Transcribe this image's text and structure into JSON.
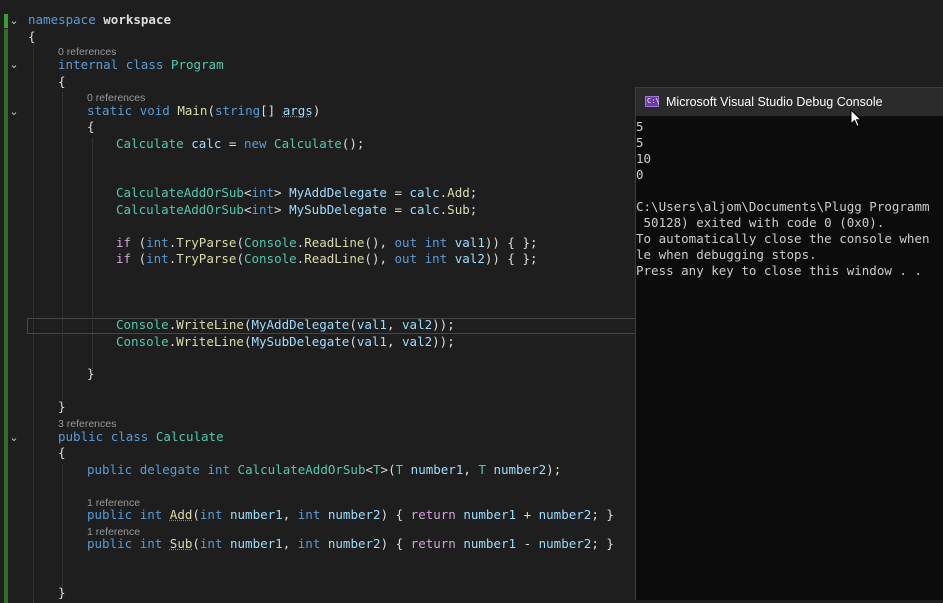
{
  "editor": {
    "lines": {
      "l1_kw": "namespace",
      "l1_name": "workspace",
      "l2": "{",
      "lens1": "0 references",
      "l3_kw1": "internal",
      "l3_kw2": "class",
      "l3_name": "Program",
      "l4": "{",
      "lens2": "0 references",
      "l5_kw1": "static",
      "l5_kw2": "void",
      "l5_fn": "Main",
      "l5_p1": "(",
      "l5_kw3": "string",
      "l5_p2": "[] ",
      "l5_arg": "args",
      "l5_p3": ")",
      "l6": "{",
      "l7_ty1": "Calculate",
      "l7_var": " calc",
      "l7_p1": " = ",
      "l7_kw": "new",
      "l7_ty2": " Calculate",
      "l7_p2": "();",
      "l8_ty": "CalculateAddOrSub",
      "l8_p1": "<",
      "l8_kw": "int",
      "l8_p2": "> ",
      "l8_var": "MyAddDelegate",
      "l8_p3": " = ",
      "l8_obj": "calc",
      "l8_p4": ".",
      "l8_m": "Add",
      "l8_p5": ";",
      "l9_ty": "CalculateAddOrSub",
      "l9_p1": "<",
      "l9_kw": "int",
      "l9_p2": "> ",
      "l9_var": "MySubDelegate",
      "l9_p3": " = ",
      "l9_obj": "calc",
      "l9_p4": ".",
      "l9_m": "Sub",
      "l9_p5": ";",
      "l10_if": "if",
      "l10_p1": " (",
      "l10_kw": "int",
      "l10_p2": ".",
      "l10_fn": "TryParse",
      "l10_p3": "(",
      "l10_ty": "Console",
      "l10_p4": ".",
      "l10_fn2": "ReadLine",
      "l10_p5": "(), ",
      "l10_out": "out",
      "l10_sp": " ",
      "l10_kw2": "int",
      "l10_var": " val1",
      "l10_p6": ")) { };",
      "l11_if": "if",
      "l11_p1": " (",
      "l11_kw": "int",
      "l11_p2": ".",
      "l11_fn": "TryParse",
      "l11_p3": "(",
      "l11_ty": "Console",
      "l11_p4": ".",
      "l11_fn2": "ReadLine",
      "l11_p5": "(), ",
      "l11_out": "out",
      "l11_sp": " ",
      "l11_kw2": "int",
      "l11_var": " val2",
      "l11_p6": ")) { };",
      "l12_ty": "Console",
      "l12_p1": ".",
      "l12_fn": "WriteLine",
      "l12_p2": "(",
      "l12_fn2": "MyAddDelegate",
      "l12_p3": "(",
      "l12_v1": "val1",
      "l12_p4": ", ",
      "l12_v2": "val2",
      "l12_p5": "));",
      "l13_ty": "Console",
      "l13_p1": ".",
      "l13_fn": "WriteLine",
      "l13_p2": "(",
      "l13_fn2": "MySubDelegate",
      "l13_p3": "(",
      "l13_v1": "val1",
      "l13_p4": ", ",
      "l13_v2": "val2",
      "l13_p5": "));",
      "l14": "}",
      "l15": "}",
      "lens3": "3 references",
      "l16_kw1": "public",
      "l16_kw2": "class",
      "l16_name": "Calculate",
      "l17": "{",
      "l18_kw1": "public",
      "l18_kw2": "delegate",
      "l18_kw3": "int",
      "l18_ty": "CalculateAddOrSub",
      "l18_p1": "<",
      "l18_t1": "T",
      "l18_p2": ">(",
      "l18_t2": "T",
      "l18_v1": " number1",
      "l18_p3": ", ",
      "l18_t3": "T",
      "l18_v2": " number2",
      "l18_p4": ");",
      "lens4": "1 reference",
      "l19_kw1": "public",
      "l19_kw2": "int",
      "l19_fn": "Add",
      "l19_p1": "(",
      "l19_kw3": "int",
      "l19_v1": " number1",
      "l19_p2": ", ",
      "l19_kw4": "int",
      "l19_v2": " number2",
      "l19_p3": ") { ",
      "l19_ret": "return",
      "l19_v3": " number1",
      "l19_p4": " + ",
      "l19_v4": "number2",
      "l19_p5": "; }",
      "lens5": "1 reference",
      "l20_kw1": "public",
      "l20_kw2": "int",
      "l20_fn": "Sub",
      "l20_p1": "(",
      "l20_kw3": "int",
      "l20_v1": " number1",
      "l20_p2": ", ",
      "l20_kw4": "int",
      "l20_v2": " number2",
      "l20_p3": ") { ",
      "l20_ret": "return",
      "l20_v3": " number1",
      "l20_p4": " - ",
      "l20_v4": "number2",
      "l20_p5": "; }",
      "l21": "}"
    }
  },
  "console": {
    "title": "Microsoft Visual Studio Debug Console",
    "icon_text": "C:\\",
    "output": [
      "5",
      "5",
      "10",
      "0",
      "",
      "C:\\Users\\aljom\\Documents\\Plugg Programm",
      " 50128) exited with code 0 (0x0).",
      "To automatically close the console when",
      "le when debugging stops.",
      "Press any key to close this window . ."
    ]
  },
  "colors": {
    "editor_bg": "#1e1e1e",
    "keyword": "#569cd6",
    "control_keyword": "#d8a0df",
    "type": "#4ec9b0",
    "method": "#dcdcaa",
    "variable": "#9cdcfe",
    "console_bg": "#0c0c0c",
    "change_bar": "#37a22e"
  },
  "icons": {
    "fold": "chevron-down-icon",
    "console": "console-app-icon",
    "cursor": "mouse-pointer-icon"
  }
}
